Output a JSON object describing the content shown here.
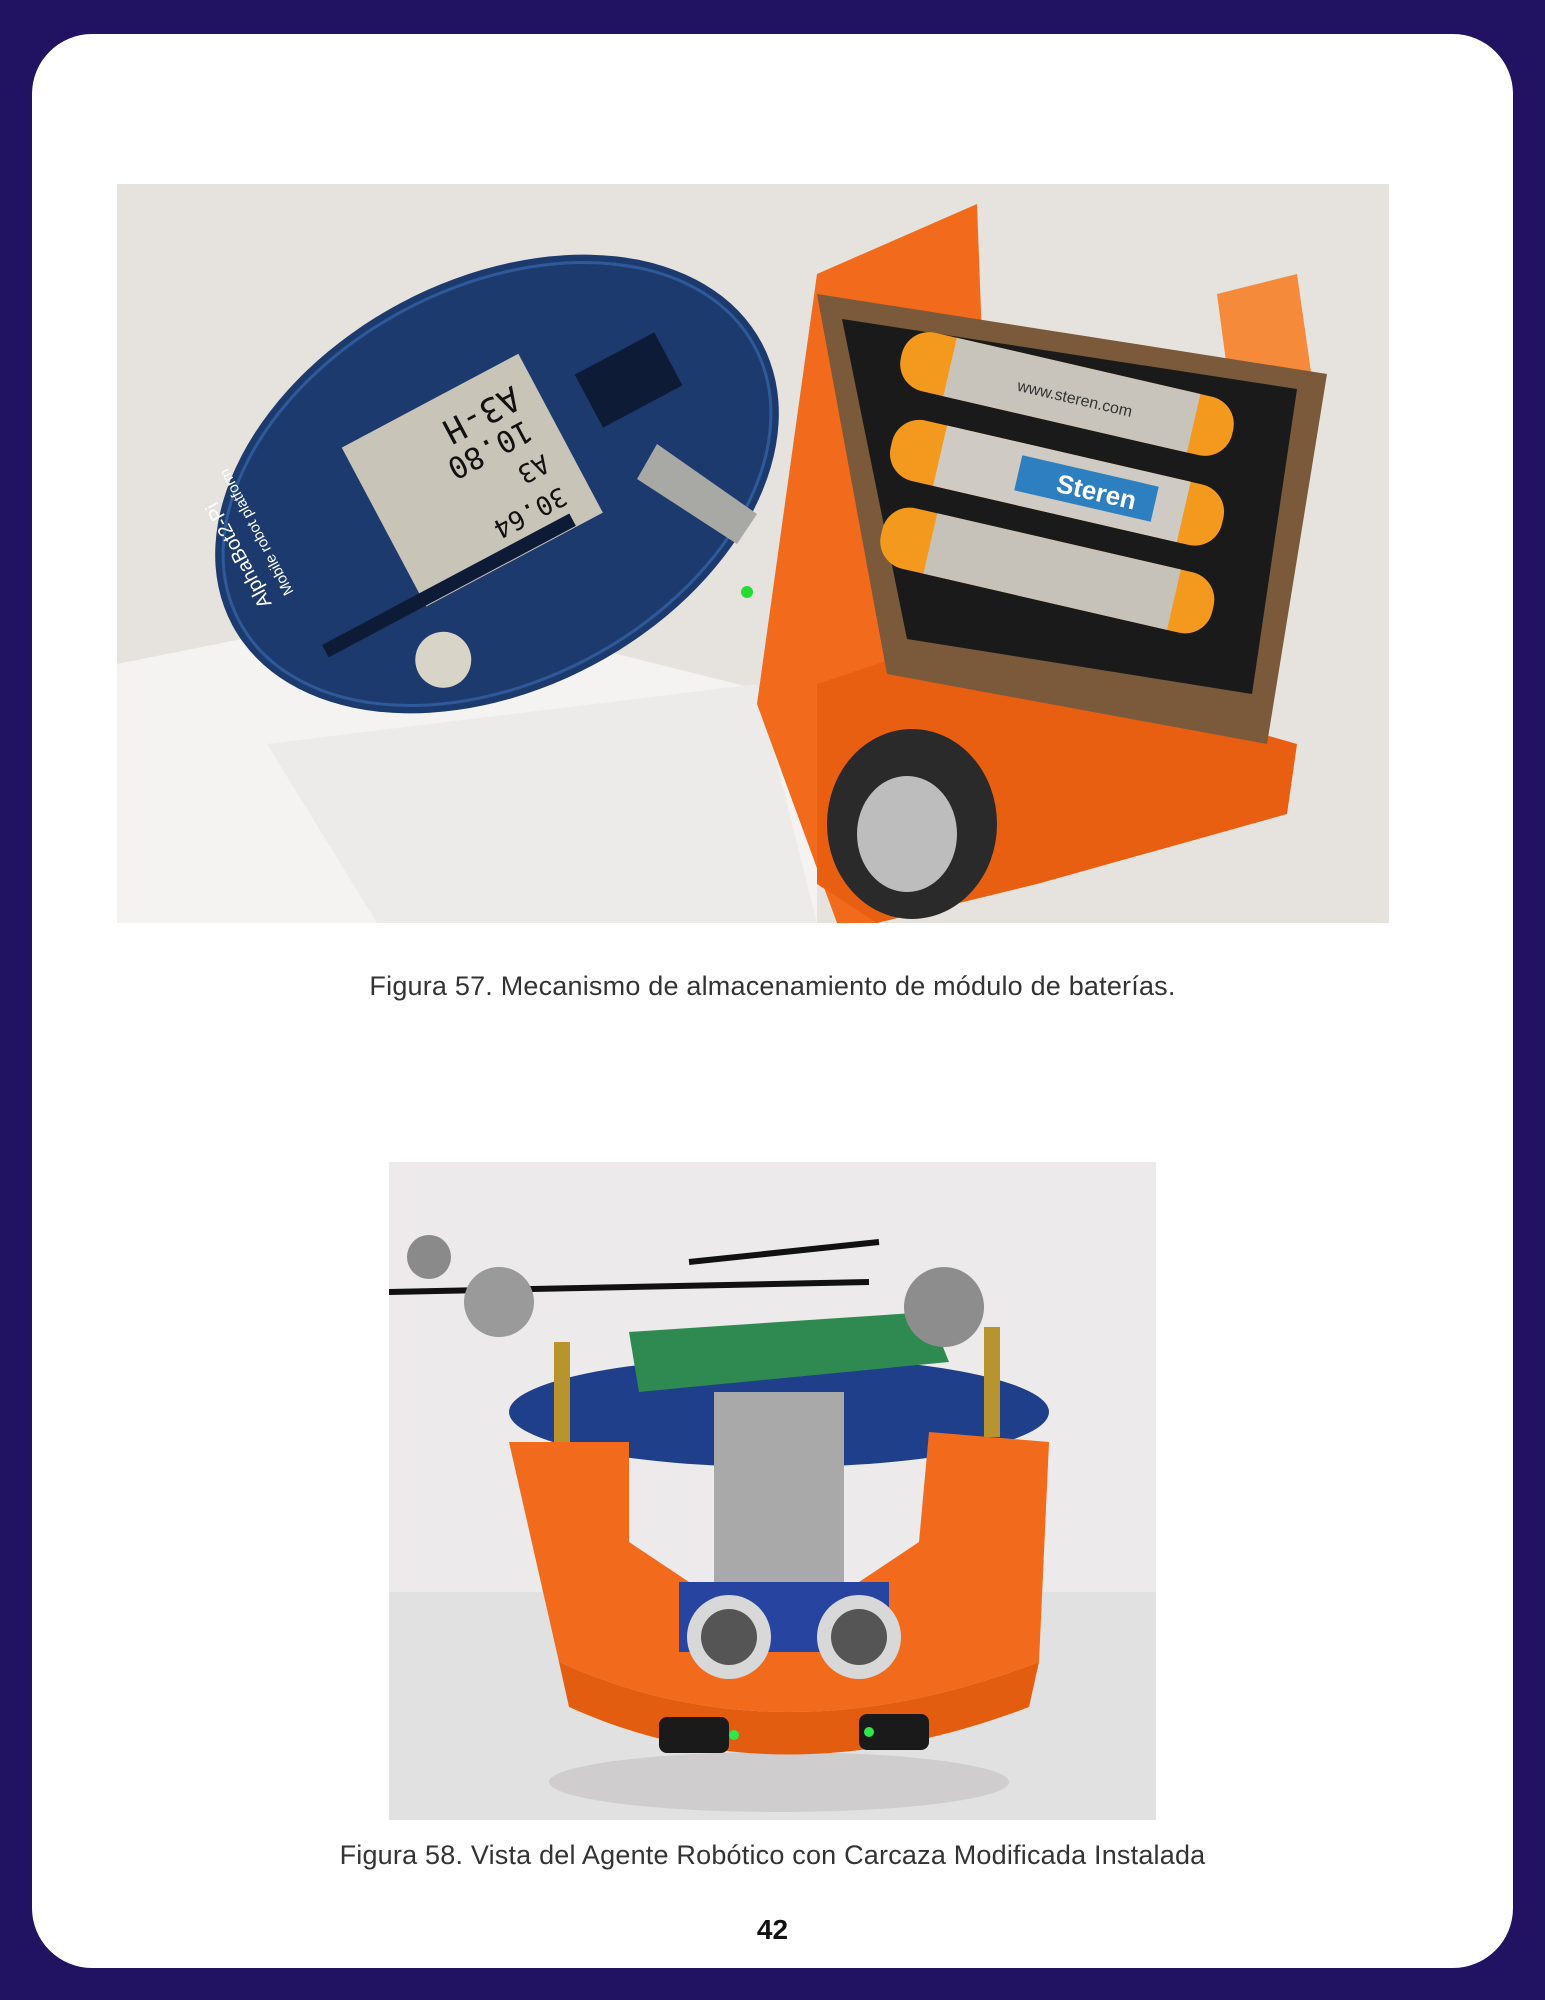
{
  "colors": {
    "page_border": "#211262",
    "page_background": "#ffffff",
    "caption_text": "#333333",
    "robot_shell": "#f26a1b",
    "pcb_blue": "#1d3a6e"
  },
  "figures": [
    {
      "caption": "Figura 57. Mecanismo de almacenamiento de módulo de baterías.",
      "photo": {
        "label_lines": [
          "A3-H",
          "10.80",
          "A3",
          "30.64"
        ],
        "board_text": "AlphaBot2-Pi",
        "board_subtext": "Mobile robot platform",
        "battery_brand": "Steren",
        "battery_url": "www.steren.com"
      }
    },
    {
      "caption": "Figura 58. Vista del Agente Robótico con Carcaza Modificada Instalada"
    }
  ],
  "page_number": "42"
}
